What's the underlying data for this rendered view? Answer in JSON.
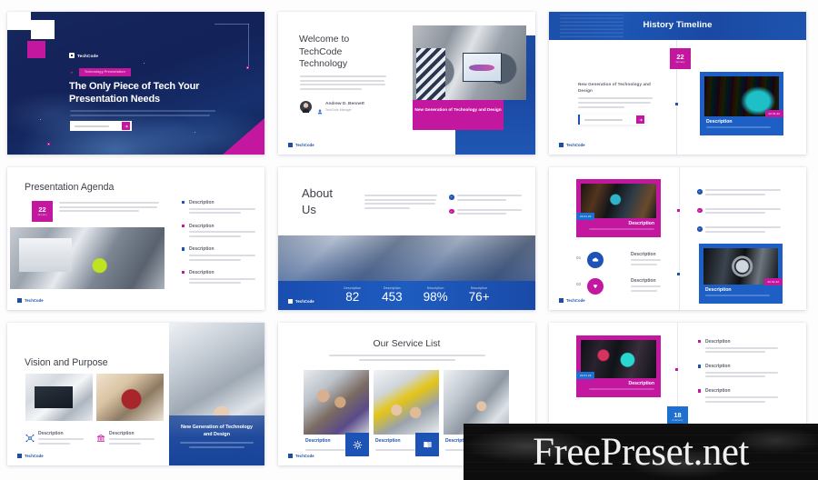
{
  "brand": {
    "name": "TechCode"
  },
  "slides": [
    {
      "id": "cover",
      "brand": "TechCode",
      "tag": "Technology Presentation",
      "title": "The Only Piece of Tech Your Presentation Needs",
      "body": "But I must explain to you how all this mistaken idea of denouncing pleasure and praising pain was born and I will give you a complete account of the system.",
      "search_placeholder": "www.techcode.com",
      "search_icon": "arrow-right-icon"
    },
    {
      "id": "welcome",
      "title": "Welcome to TechCode Technology",
      "body": "But I must explain to you how all this mistaken idea of denouncing pleasure and praising pain was born and I will give you a complete account of the system and expounding actual teachings.",
      "author_name": "Andrew D. Bennett",
      "author_role": "TechCode Manager",
      "caption": "New Generation of Technology and Design",
      "footer_brand": "TechCode"
    },
    {
      "id": "history-timeline",
      "header": "History Timeline",
      "badge_number": "22",
      "badge_label": "January",
      "item_title": "New Generation of Technology and Design",
      "item_body": "But I must explain to you how all this mistaken idea of denouncing pleasure and praising pain was born and I will give you a complete account.",
      "input_placeholder": "www.techcode.com",
      "card_title": "Description",
      "card_body": "But I must explain you denouncing pleasure",
      "card_tag": "22.01.22",
      "footer_brand": "TechCode"
    },
    {
      "id": "presentation-agenda",
      "title": "Presentation Agenda",
      "badge_number": "22",
      "badge_label": "January",
      "body": "But I must explain to you how all this mistaken idea of denouncing pleasure and praising pain was born and I will give you a complete account of the system and expounding the actual teaching.",
      "bullets": [
        {
          "title": "Description",
          "body": "But I must explain to you how all this denouncing pleasure and praising",
          "color": "#1d53b4"
        },
        {
          "title": "Description",
          "body": "But I must explain to you how all this denouncing pleasure and praising",
          "color": "#c3179f"
        },
        {
          "title": "Description",
          "body": "But I must explain to you how all this denouncing pleasure and praising",
          "color": "#1d53b4"
        },
        {
          "title": "Description",
          "body": "But I must explain to you how all this denouncing pleasure and praising",
          "color": "#c3179f"
        }
      ],
      "footer_brand": "TechCode"
    },
    {
      "id": "about-us",
      "title": "About Us",
      "body": "But I must explain to you how all this mistaken idea of denouncing pleasure and of praising pain was born and I will give you a complete account of the system that expounds the actual teaching.",
      "checks": [
        {
          "body": "But I must explain to you how all this denouncing pleasure and praising",
          "color": "#1d53b4"
        },
        {
          "body": "But I must explain to you how all this denouncing pleasure and praising",
          "color": "#c3179f"
        }
      ],
      "stats": [
        {
          "label": "Description",
          "value": "82"
        },
        {
          "label": "Description",
          "value": "453"
        },
        {
          "label": "Description",
          "value": "98%"
        },
        {
          "label": "Description",
          "value": "76+"
        }
      ],
      "footer_brand": "TechCode"
    },
    {
      "id": "timeline-cards",
      "pink_card": {
        "title": "Description",
        "body": "But I must explain you denouncing pleasure",
        "tag": "22.01.22"
      },
      "blue_card": {
        "title": "Description",
        "body": "But I must explain you denouncing pleasure",
        "tag": "22.01.22"
      },
      "numbered": [
        {
          "num": "01",
          "title": "Description",
          "body": "But I must explain to you how all mistaken idea denouncing",
          "color": "#1d53b4",
          "icon": "cloud-icon"
        },
        {
          "num": "02",
          "title": "Description",
          "body": "But I must explain to you how all mistaken idea denouncing",
          "color": "#c3179f",
          "icon": "rocket-icon"
        }
      ],
      "checks": [
        {
          "body": "But I must explain to you how all this mistaken idea of denouncing pleasure and praising pain",
          "color": "#1d53b4"
        },
        {
          "body": "But I must explain to you how all this mistaken idea of denouncing pleasure and praising pain",
          "color": "#c3179f"
        },
        {
          "body": "But I must explain to you how all this mistaken idea of denouncing pleasure and praising pain",
          "color": "#1d53b4"
        }
      ],
      "footer_brand": "TechCode"
    },
    {
      "id": "vision-and-purpose",
      "title": "Vision and Purpose",
      "items": [
        {
          "title": "Description",
          "body": "But I must explain to you how denouncing pleasure",
          "color": "#1d53b4",
          "icon": "network-icon"
        },
        {
          "title": "Description",
          "body": "But I must explain to you how denouncing pleasure",
          "color": "#c3179f",
          "icon": "bank-icon"
        }
      ],
      "caption_title": "New Generation of Technology and Design",
      "caption_body": "But I must explain to you how all this mistaken idea of denouncing pleasure",
      "footer_brand": "TechCode"
    },
    {
      "id": "our-service-list",
      "title": "Our Service List",
      "subtitle": "But I must explain to you how all this mistaken idea of denouncing pleasure and praising pain was born and I will give you a complete account of the system and expounding actual teachings.",
      "cards": [
        {
          "title": "Description",
          "body": "But I must explain to you",
          "icon": "settings-gear-icon"
        },
        {
          "title": "Description",
          "body": "But I must explain to you",
          "icon": "book-icon"
        },
        {
          "title": "Description",
          "body": "But I must explain to you",
          "icon": "chart-icon"
        }
      ],
      "footer_brand": "TechCode"
    },
    {
      "id": "pink-timeline",
      "card": {
        "title": "Description",
        "body": "But I must explain you denouncing pleasure",
        "tag": "22.01.22"
      },
      "badge_number": "18",
      "badge_label": "February",
      "bullets": [
        {
          "title": "Description",
          "body": "But I must explain to you how all this mistaken idea of denouncing pleasure and praising pain",
          "color": "#c3179f"
        },
        {
          "title": "Description",
          "body": "But I must explain to you how all this mistaken idea of denouncing pleasure and praising pain",
          "color": "#1d53b4"
        },
        {
          "title": "Description",
          "body": "But I must explain to you how all this mistaken idea of denouncing pleasure and praising pain",
          "color": "#c3179f"
        }
      ]
    }
  ],
  "watermark": {
    "text": "FreePreset.net"
  },
  "colors": {
    "navy": "#12235c",
    "blue": "#1d53b4",
    "magenta": "#c3179f",
    "white": "#ffffff"
  }
}
